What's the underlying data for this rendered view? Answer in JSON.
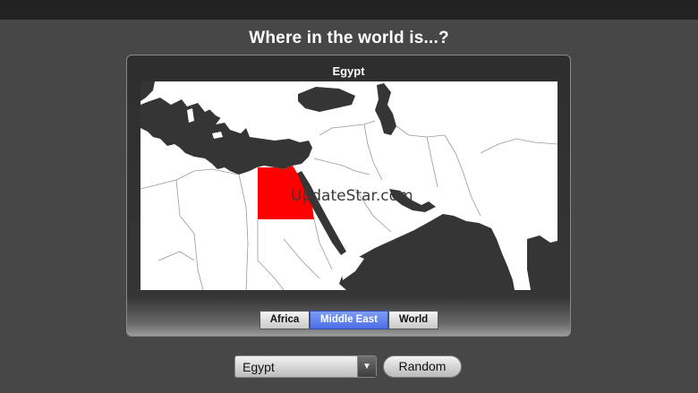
{
  "page": {
    "title": "Where in the world is...?"
  },
  "panel": {
    "country_label": "Egypt",
    "watermark": "UpdateStar.com",
    "highlight_color": "#ff0000"
  },
  "regions": [
    {
      "label": "Africa",
      "selected": false
    },
    {
      "label": "Middle East",
      "selected": true
    },
    {
      "label": "World",
      "selected": false
    }
  ],
  "controls": {
    "country_select_value": "Egypt",
    "random_label": "Random"
  },
  "colors": {
    "background": "#474747",
    "selected_segment": "#5a7ff0",
    "sea": "#353535",
    "land": "#ffffff"
  }
}
